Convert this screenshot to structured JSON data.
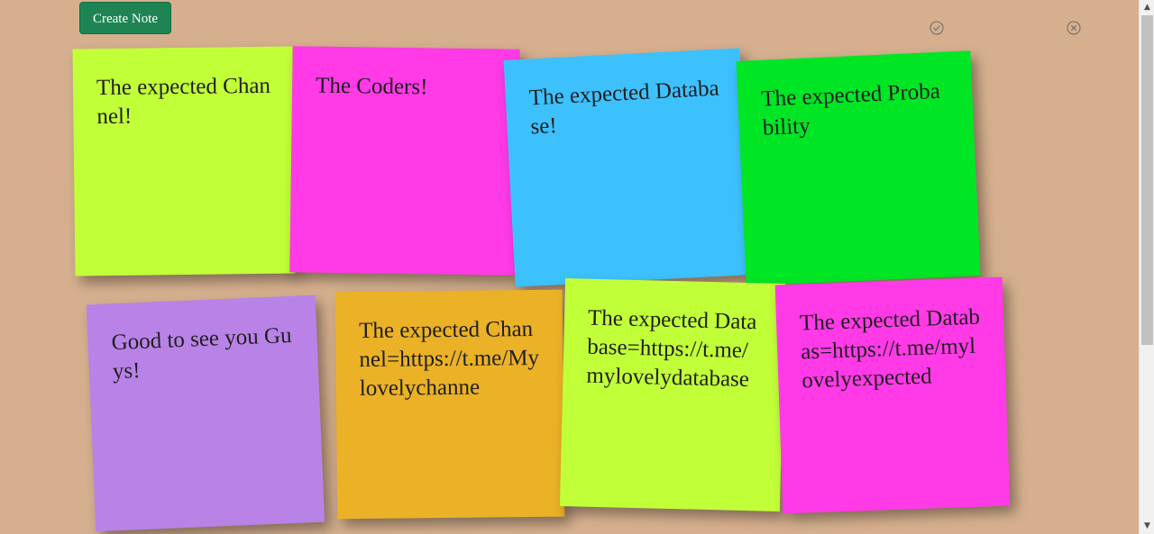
{
  "toolbar": {
    "create_label": "Create Note",
    "accept_icon": "check-circle-icon",
    "close_icon": "close-circle-icon"
  },
  "notes": [
    {
      "text": "The expected Channel!",
      "color": "#c1ff39"
    },
    {
      "text": "The Coders!",
      "color": "#ff3ae6"
    },
    {
      "text": "The expected Database!",
      "color": "#3dc1fd"
    },
    {
      "text": "The expected Probability",
      "color": "#00e625"
    },
    {
      "text": "Good to see you Guys!",
      "color": "#b982e7"
    },
    {
      "text": "The expected Channel=https://t.me/Mylovelychanne",
      "color": "#ebb127"
    },
    {
      "text": "The expected Database=https://t.me/mylovelydatabase",
      "color": "#c1ff39"
    },
    {
      "text": "The expected Databas=https://t.me/mylovelyexpected",
      "color": "#ff3ae6"
    }
  ],
  "scrollbar": {
    "up_icon": "arrow-up-icon",
    "down_icon": "arrow-down-icon"
  }
}
